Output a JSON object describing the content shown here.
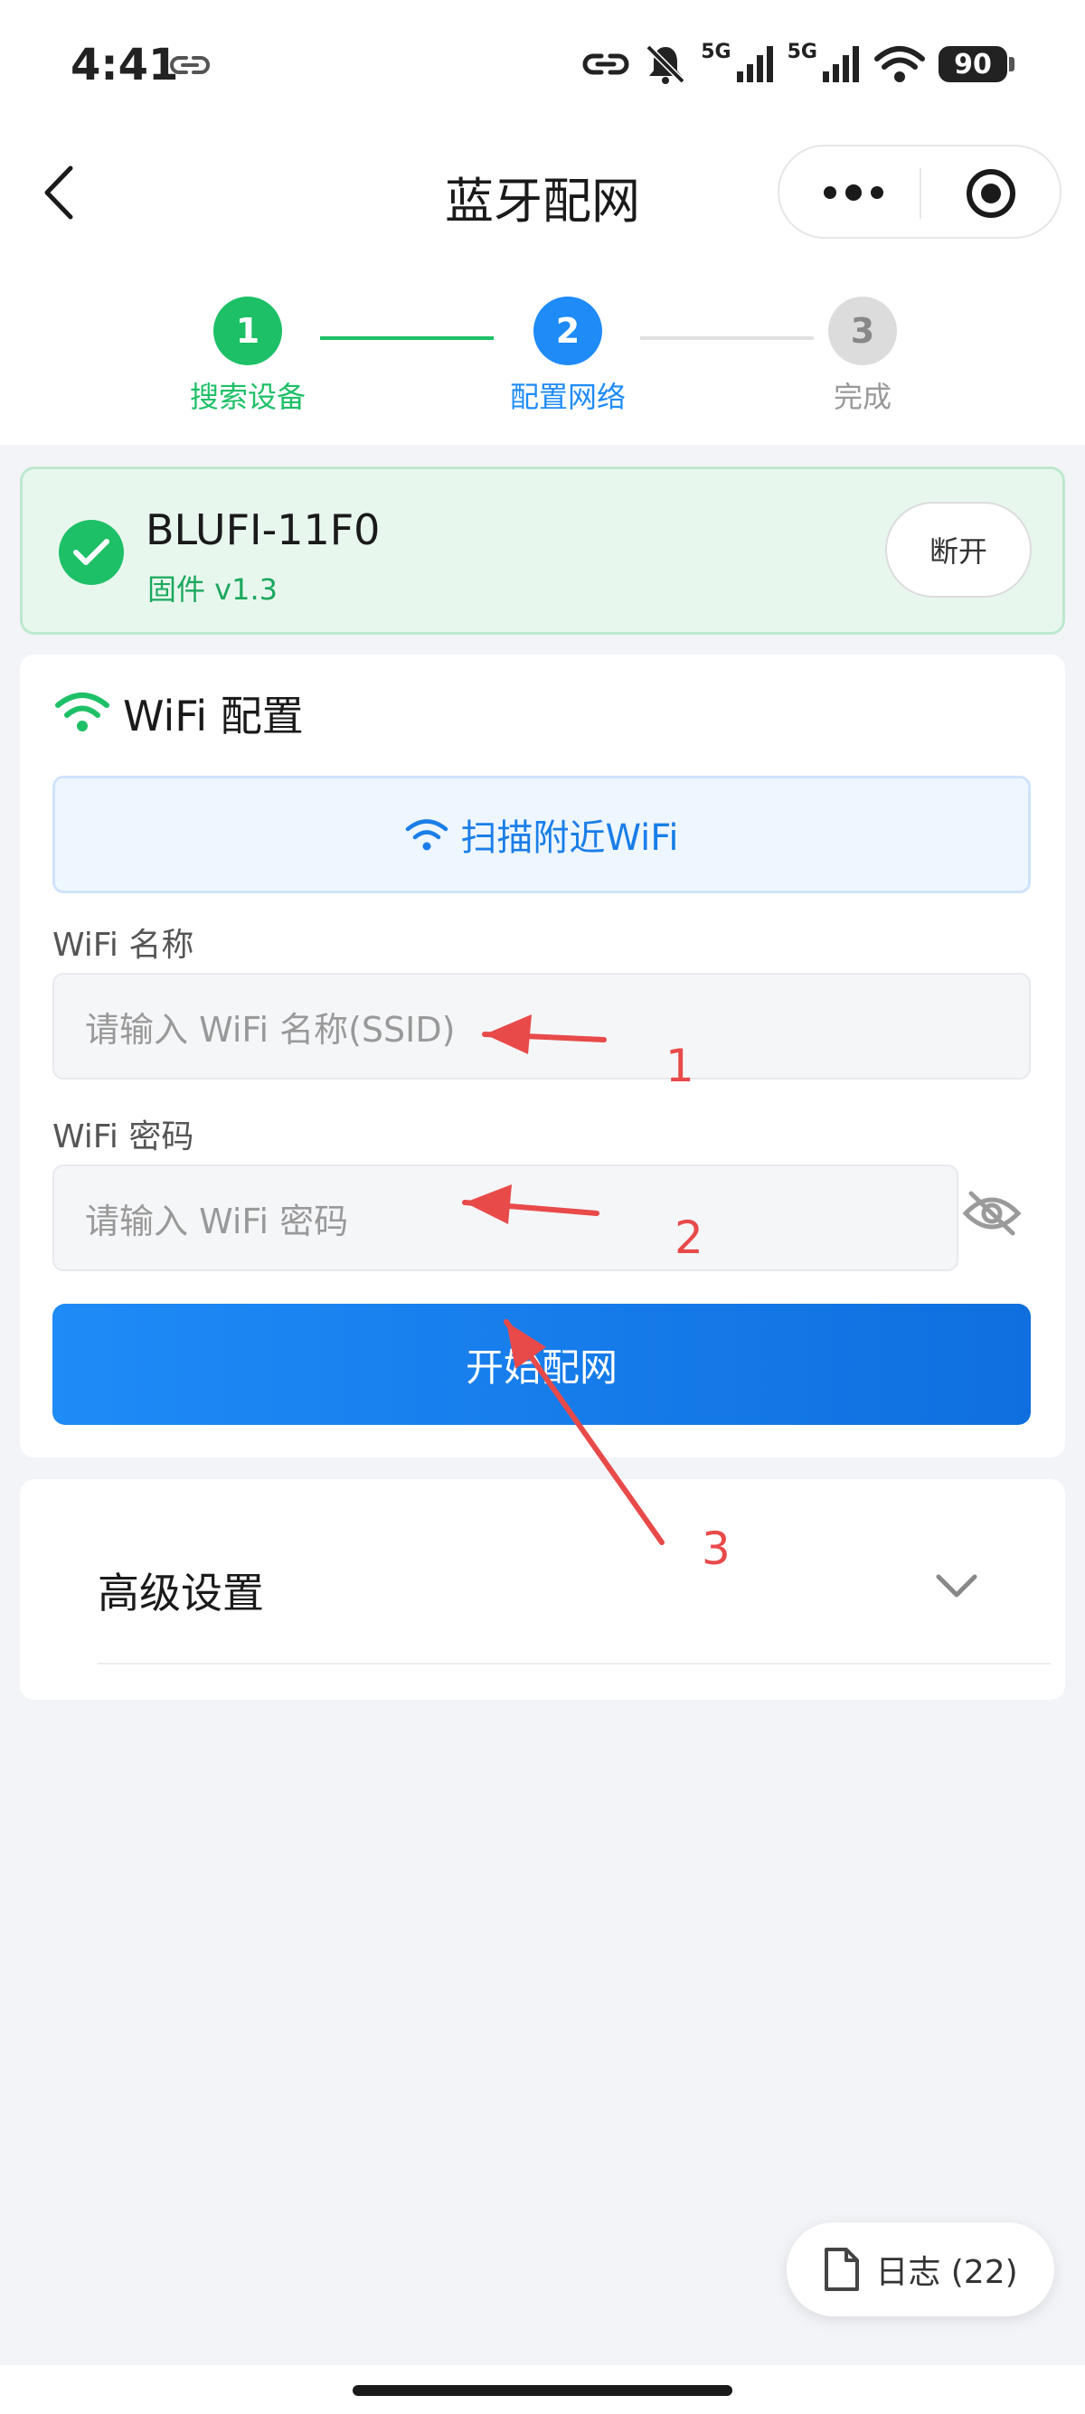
{
  "status_bar": {
    "time": "4:41",
    "signal1_label": "5G",
    "signal2_label": "5G",
    "battery": "90"
  },
  "nav": {
    "title": "蓝牙配网"
  },
  "stepper": {
    "steps": [
      {
        "number": "1",
        "label": "搜索设备",
        "state": "done",
        "color": "#1ec067"
      },
      {
        "number": "2",
        "label": "配置网络",
        "state": "active",
        "color": "#1e8bf7"
      },
      {
        "number": "3",
        "label": "完成",
        "state": "pending",
        "color": "#dcdcdc"
      }
    ]
  },
  "device": {
    "name": "BLUFI-11F0",
    "firmware": "固件 v1.3",
    "disconnect_label": "断开"
  },
  "wifi": {
    "title": "WiFi 配置",
    "scan_label": "扫描附近WiFi",
    "ssid_label": "WiFi 名称",
    "ssid_placeholder": "请输入 WiFi 名称(SSID)",
    "password_label": "WiFi 密码",
    "password_placeholder": "请输入 WiFi 密码",
    "start_label": "开始配网"
  },
  "advanced": {
    "title": "高级设置"
  },
  "annotations": {
    "n1": "1",
    "n2": "2",
    "n3": "3",
    "color": "#e84a4a"
  },
  "log": {
    "label": "日志 (22)"
  },
  "colors": {
    "primary": "#1e8bf7",
    "success": "#1ec067",
    "background": "#f3f4f8"
  }
}
